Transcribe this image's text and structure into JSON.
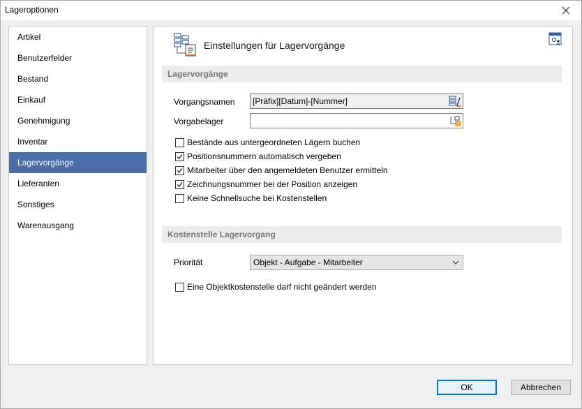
{
  "window": {
    "title": "Lageroptionen"
  },
  "sidebar": {
    "items": [
      {
        "label": "Artikel"
      },
      {
        "label": "Benutzerfelder"
      },
      {
        "label": "Bestand"
      },
      {
        "label": "Einkauf"
      },
      {
        "label": "Genehmigung"
      },
      {
        "label": "Inventar"
      },
      {
        "label": "Lagervorgänge",
        "selected": true
      },
      {
        "label": "Lieferanten"
      },
      {
        "label": "Sonstiges"
      },
      {
        "label": "Warenausgang"
      }
    ]
  },
  "header": {
    "title": "Einstellungen für Lagervorgänge"
  },
  "section1": {
    "title": "Lagervorgänge",
    "vorgangsnamen_label": "Vorgangsnamen",
    "vorgangsnamen_value": "[Präfix][Datum]-[Nummer]",
    "vorgabelager_label": "Vorgabelager",
    "vorgabelager_value": "",
    "checkboxes": [
      {
        "label": "Bestände aus untergeordneten Lägern buchen",
        "checked": false
      },
      {
        "label": "Positionsnummern automatisch vergeben",
        "checked": true
      },
      {
        "label": "Mitarbeiter über den angemeldeten Benutzer ermitteln",
        "checked": true
      },
      {
        "label": "Zeichnungsnummer bei der Position anzeigen",
        "checked": true
      },
      {
        "label": "Keine Schnellsuche bei Kostenstellen",
        "checked": false
      }
    ]
  },
  "section2": {
    "title": "Kostenstelle Lagervorgang",
    "prioritaet_label": "Priorität",
    "prioritaet_value": "Objekt - Aufgabe - Mitarbeiter",
    "checkbox": {
      "label": "Eine Objektkostenstelle darf nicht geändert werden",
      "checked": false
    }
  },
  "footer": {
    "ok_label": "OK",
    "cancel_label": "Abbrechen"
  },
  "colors": {
    "selection": "#4a6fa8",
    "focus": "#0078d7"
  }
}
